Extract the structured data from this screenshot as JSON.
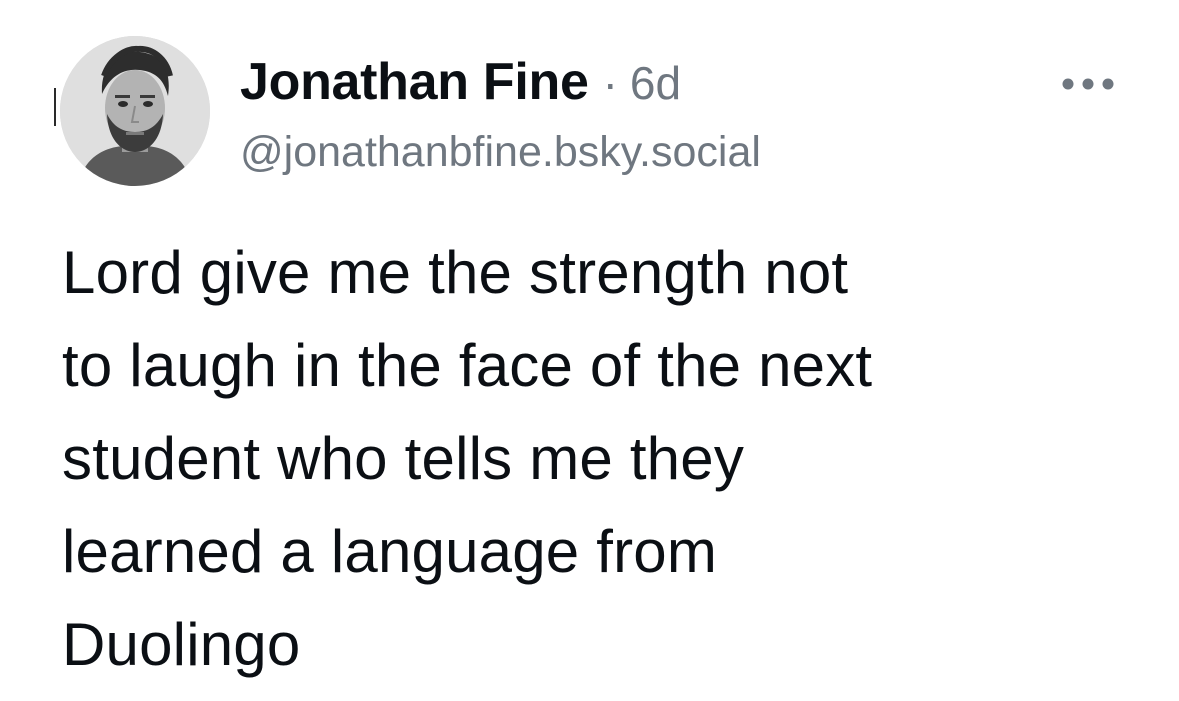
{
  "post": {
    "author": {
      "display_name": "Jonathan Fine",
      "handle": "@jonathanbfine.bsky.social",
      "avatar_icon": "avatar-photo"
    },
    "separator": "·",
    "timestamp": "6d",
    "menu_icon": "more-options-icon",
    "text_lines": [
      "Lord give me the strength not",
      "to laugh in the face of the next",
      "student who tells me they",
      "learned a language from",
      "Duolingo"
    ]
  },
  "colors": {
    "text": "#0b0f14",
    "secondary": "#6f7780",
    "background": "#ffffff"
  }
}
